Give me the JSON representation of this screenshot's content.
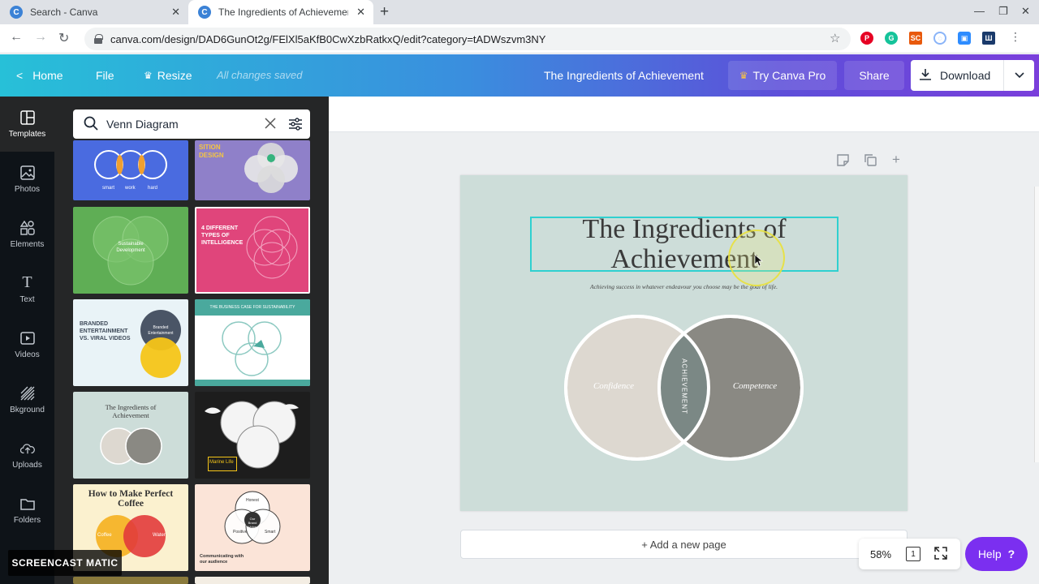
{
  "browser": {
    "tabs": [
      {
        "favicon": "C",
        "title": "Search - Canva",
        "active": false
      },
      {
        "favicon": "C",
        "title": "The Ingredients of Achievement",
        "active": true
      }
    ],
    "url": "canva.com/design/DAD6GunOt2g/FElXl5aKfB0CwXzbRatkxQ/edit?category=tADWszvm3NY",
    "extensions": [
      {
        "icon": "pinterest-icon",
        "label": "P",
        "color": "#e60023"
      },
      {
        "icon": "grammarly-icon",
        "label": "G",
        "color": "#15c39a"
      },
      {
        "icon": "screencast-icon",
        "label": "SC",
        "color": "#e8590c"
      },
      {
        "icon": "extension-icon",
        "label": "◌",
        "color": "#8ab4f8"
      },
      {
        "icon": "zoom-icon",
        "label": "▣",
        "color": "#2d8cff"
      },
      {
        "icon": "reader-icon",
        "label": "Ш",
        "color": "#1a3a6b"
      }
    ]
  },
  "topbar": {
    "home": "Home",
    "file": "File",
    "resize": "Resize",
    "saved": "All changes saved",
    "design_title": "The Ingredients of Achievement",
    "try_pro": "Try Canva Pro",
    "share": "Share",
    "download": "Download"
  },
  "rail": [
    {
      "icon": "templates-icon",
      "label": "Templates",
      "active": true
    },
    {
      "icon": "photos-icon",
      "label": "Photos"
    },
    {
      "icon": "elements-icon",
      "label": "Elements"
    },
    {
      "icon": "text-icon",
      "label": "Text"
    },
    {
      "icon": "videos-icon",
      "label": "Videos"
    },
    {
      "icon": "background-icon",
      "label": "Bkground"
    },
    {
      "icon": "uploads-icon",
      "label": "Uploads"
    },
    {
      "icon": "folders-icon",
      "label": "Folders"
    }
  ],
  "search": {
    "value": "Venn Diagram"
  },
  "templates": {
    "t1_words": [
      "smart",
      "work",
      "hard"
    ],
    "t2_title": "SITION DESIGN",
    "t3_center": "Sustainable Development",
    "t4_title": "4 DIFFERENT TYPES OF INTELLIGENCE",
    "t5_title": "BRANDED ENTERTAINMENT VS. VIRAL VIDEOS",
    "t5_circle": "Branded Entertainment",
    "t6_title": "THE BUSINESS CASE FOR SUSTAINABILITY",
    "t7_title": "The Ingredients of Achievement",
    "t8_label": "Marine Life",
    "t9_title": "How to Make Perfect Coffee",
    "t9_left": "Coffee",
    "t9_right": "Water",
    "t10_center": "Our Brand Voice",
    "t10_top": "Honest",
    "t10_left": "Positive",
    "t10_right": "Smart",
    "t10_caption": "Communicating with our audience"
  },
  "design": {
    "title": "The Ingredients of Achievement",
    "subtitle": "Achieving success in whatever endeavour you choose may be the goal of life.",
    "left": "Confidence",
    "center": "ACHIEVEMENT",
    "right": "Competence",
    "colors": {
      "bg": "#cdddd9",
      "left": "#ddd8d0",
      "right": "#8a8983",
      "center": "#7b8885"
    }
  },
  "editor": {
    "add_page": "+ Add a new page",
    "zoom": "58%",
    "page_count": "1",
    "help": "Help"
  },
  "watermark": "SCREENCAST MATIC"
}
